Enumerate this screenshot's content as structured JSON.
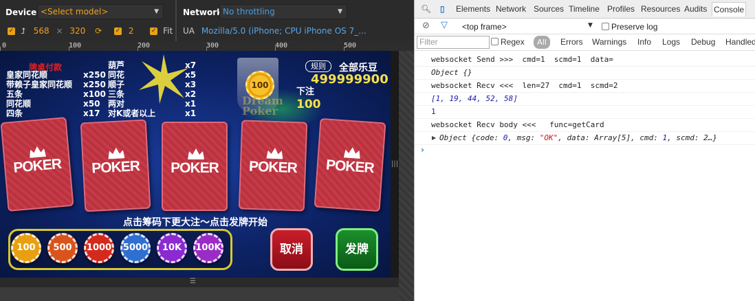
{
  "emulation": {
    "device_label": "Device",
    "device_select": "<Select model>",
    "network_label": "Network",
    "network_select": "No throttling",
    "width": "568",
    "times": "×",
    "height": "320",
    "scale": "2",
    "fit_label": "Fit",
    "ua_label": "UA",
    "ua_value": "Mozilla/5.0 (iPhone; CPU iPhone OS 7_..."
  },
  "ruler": {
    "ticks": [
      "0",
      "100",
      "200",
      "300",
      "400",
      "500"
    ]
  },
  "game": {
    "paytable_title": "牌桌付款",
    "paytable_left_names": [
      "皇家同花顺",
      "带赖子皇家同花顺",
      "五条",
      "同花顺",
      "四条"
    ],
    "paytable_left_odds": [
      "x250",
      "x250",
      "x100",
      "x50",
      "x17"
    ],
    "paytable_right_names": [
      "葫芦",
      "同花",
      "顺子",
      "三条",
      "两对",
      "对K或者以上"
    ],
    "paytable_right_odds": [
      "x7",
      "x5",
      "x3",
      "x2",
      "x1",
      "x1"
    ],
    "logo_chip": "100",
    "logo_text_1": "Dream",
    "logo_text_2": "Poker",
    "rules_button": "规则",
    "gold_label": "全部乐豆",
    "gold_value": "499999900",
    "bet_label": "下注",
    "bet_value": "100",
    "cards": [
      "POKER",
      "POKER",
      "POKER",
      "POKER",
      "POKER"
    ],
    "hint": "点击筹码下更大注～点击发牌开始",
    "chips": [
      {
        "label": "100",
        "color": "#e8a010"
      },
      {
        "label": "500",
        "color": "#d9541c"
      },
      {
        "label": "1000",
        "color": "#d42a1e"
      },
      {
        "label": "5000",
        "color": "#2f6fd0"
      },
      {
        "label": "10K",
        "color": "#8a2ad0"
      },
      {
        "label": "100K",
        "color": "#9a2cc6"
      }
    ],
    "cancel_button": "取消",
    "deal_button": "发牌"
  },
  "devtools": {
    "tabs": [
      "Elements",
      "Network",
      "Sources",
      "Timeline",
      "Profiles",
      "Resources",
      "Audits",
      "Console"
    ],
    "active_tab": "Console",
    "frame_select": "<top frame>",
    "preserve_log": "Preserve log",
    "filter_placeholder": "Filter",
    "regex": "Regex",
    "levels": [
      "All",
      "Errors",
      "Warnings",
      "Info",
      "Logs",
      "Debug",
      "Handled"
    ],
    "console": {
      "line1": "websocket Send >>>  cmd=1  scmd=1  data=",
      "line2": "Object {}",
      "line3": "websocket Recv <<<  len=27  cmd=1  scmd=2",
      "line4": "[1, 19, 44, 52, 58]",
      "line5": "1",
      "line6": "websocket Recv body <<<   func=getCard",
      "obj_prefix": "Object {",
      "obj_k1": "code: ",
      "obj_v1": "0",
      "obj_k2": ", msg: ",
      "obj_v2": "\"OK\"",
      "obj_k3": ", data: Array[5], cmd: ",
      "obj_v3": "1",
      "obj_k4": ", scmd: 2…}"
    }
  }
}
